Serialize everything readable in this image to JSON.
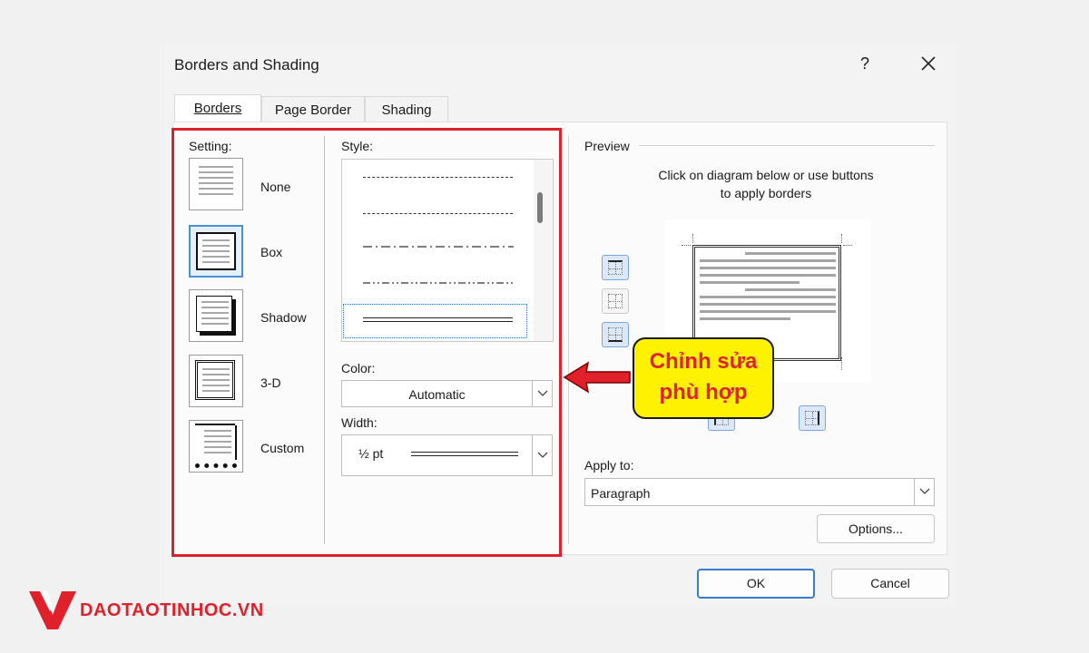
{
  "dialog": {
    "title": "Borders and Shading",
    "help": "?",
    "close_label": ""
  },
  "tabs": [
    {
      "label": "Borders",
      "underline": "B"
    },
    {
      "label": "Page Border",
      "underline": "P"
    },
    {
      "label": "Shading",
      "underline": "S"
    }
  ],
  "setting": {
    "heading": "Setting:",
    "options": [
      "None",
      "Box",
      "Shadow",
      "3-D",
      "Custom"
    ],
    "selected": "Box"
  },
  "style": {
    "heading": "Style:"
  },
  "color": {
    "heading": "Color:",
    "value": "Automatic"
  },
  "width": {
    "heading": "Width:",
    "value": "½ pt"
  },
  "preview": {
    "heading": "Preview",
    "instruction_line1": "Click on diagram below or use buttons",
    "instruction_line2": "to apply borders"
  },
  "apply_to": {
    "heading": "Apply to:",
    "value": "Paragraph"
  },
  "buttons": {
    "options": "Options...",
    "ok": "OK",
    "cancel": "Cancel"
  },
  "annotation": {
    "line1": "Chỉnh sửa",
    "line2": "phù hợp"
  },
  "brand": {
    "text": "DAOTAOTINHOC.VN"
  },
  "colors": {
    "highlight_border": "#e0202a",
    "callout_fill": "#fff200",
    "accent": "#3a7bd5"
  }
}
